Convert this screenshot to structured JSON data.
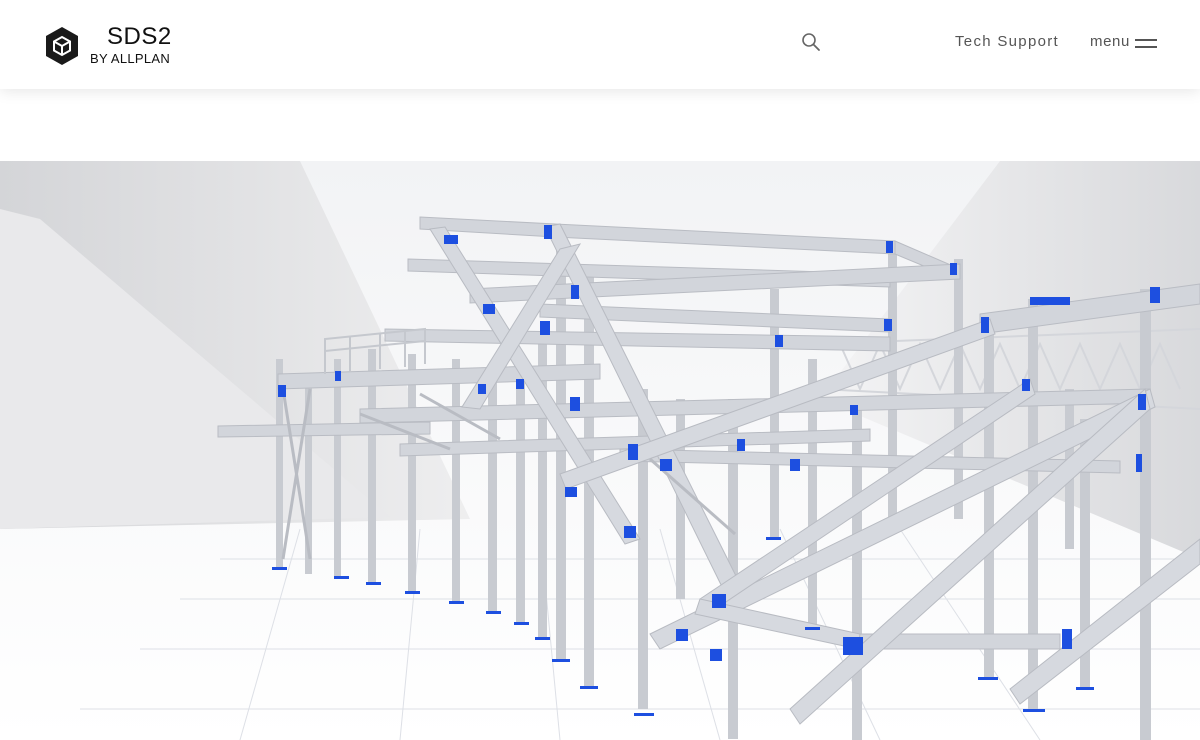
{
  "brand": {
    "name": "SDS2",
    "tagline": "BY ALLPLAN"
  },
  "header": {
    "search_icon": "search-icon",
    "nav_links": [
      {
        "label": "Tech Support"
      }
    ],
    "menu": {
      "label": "menu",
      "icon": "hamburger-icon"
    }
  },
  "hero": {
    "image_subject": "3D steel structure model",
    "accent_color": "#1d4fe0",
    "steel_color": "#c9ccd2"
  }
}
